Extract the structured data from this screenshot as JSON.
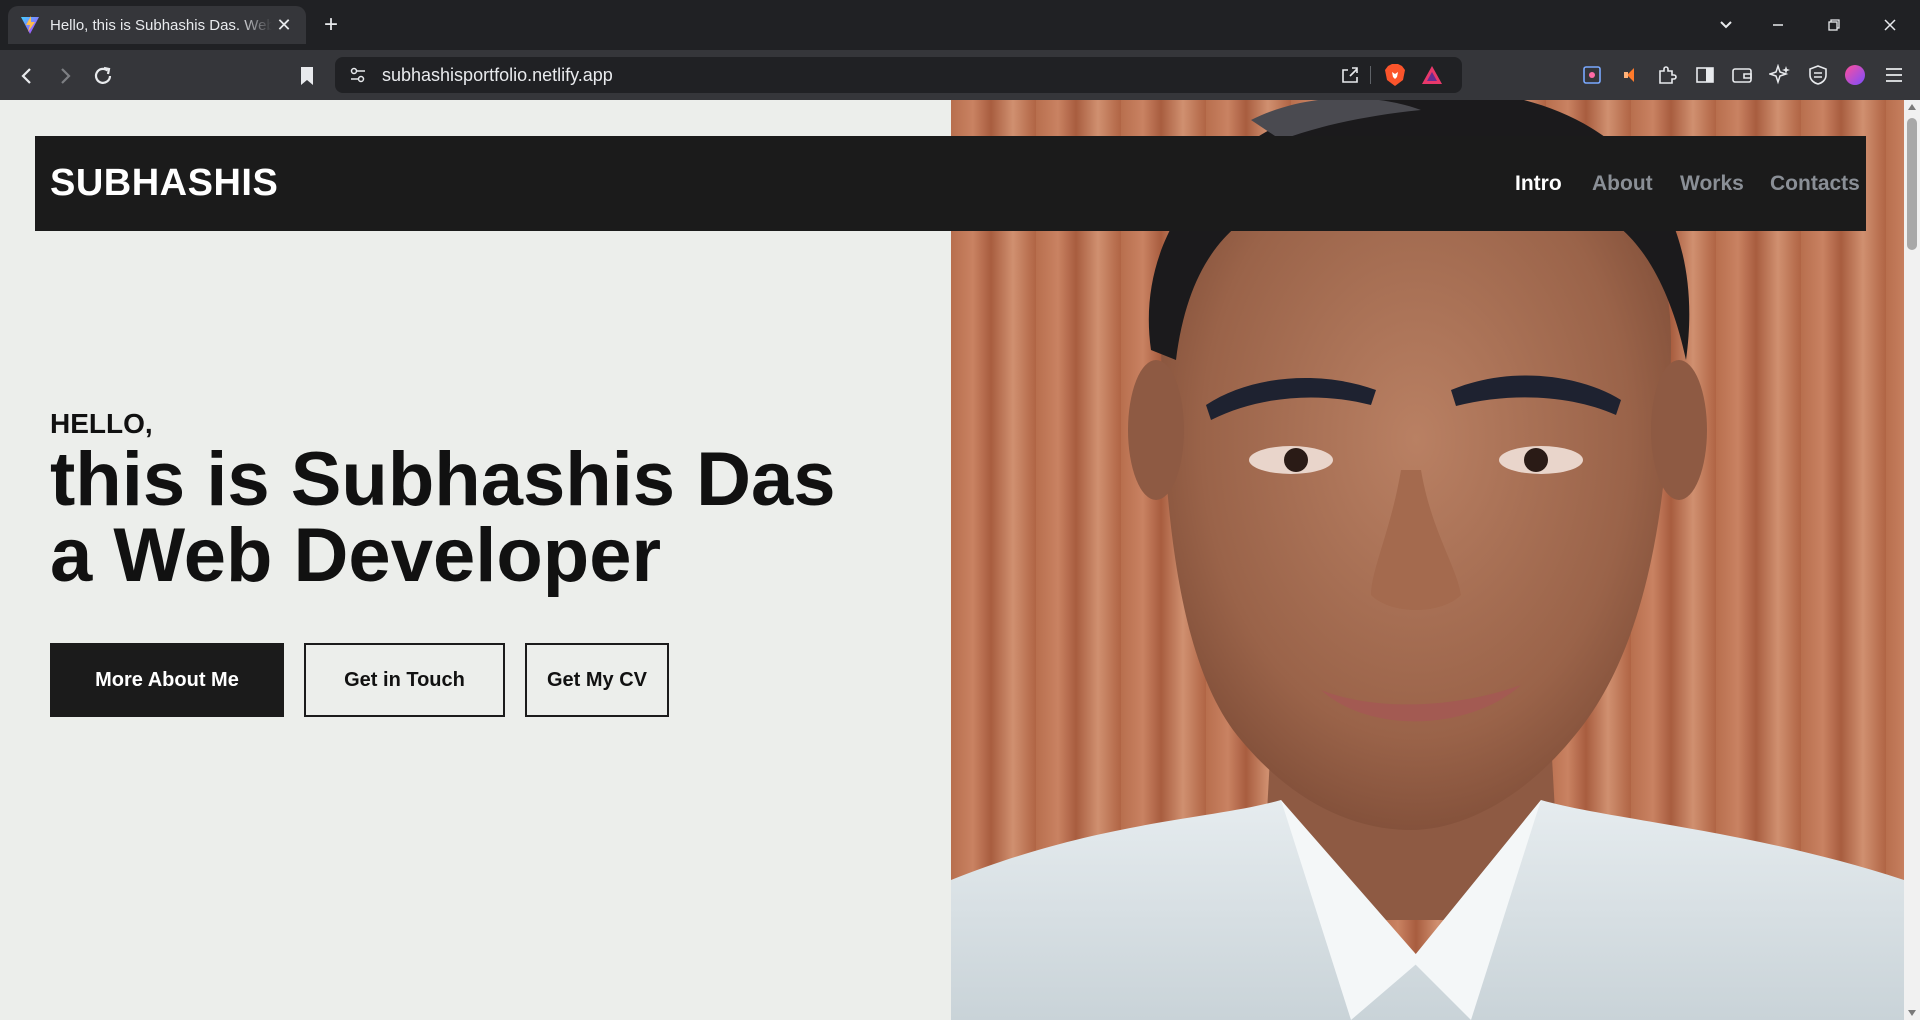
{
  "browser": {
    "tab_title": "Hello, this is Subhashis Das. Web Developer",
    "url": "subhashisportfolio.netlify.app"
  },
  "site": {
    "logo": "SUBHASHIS",
    "nav": [
      "Intro",
      "About",
      "Works",
      "Contacts"
    ],
    "active_nav": "Intro"
  },
  "hero": {
    "greeting": "HELLO,",
    "line1": "this is Subhashis Das",
    "line2": "a Web Developer",
    "buttons": [
      "More About Me",
      "Get in Touch",
      "Get My CV"
    ]
  },
  "colors": {
    "page_background": "#eceeeb",
    "nav_background": "#1b1b1b",
    "nav_link_inactive": "#8a8f96",
    "text_dark": "#111111"
  },
  "icons": {
    "tab_favicon": "vite-logo-icon",
    "bookmark": "bookmark-icon",
    "site_info": "tune-icon",
    "share": "share-icon",
    "brave_shields": "brave-lion-icon",
    "brave_rewards": "triangle-rewards-icon"
  }
}
